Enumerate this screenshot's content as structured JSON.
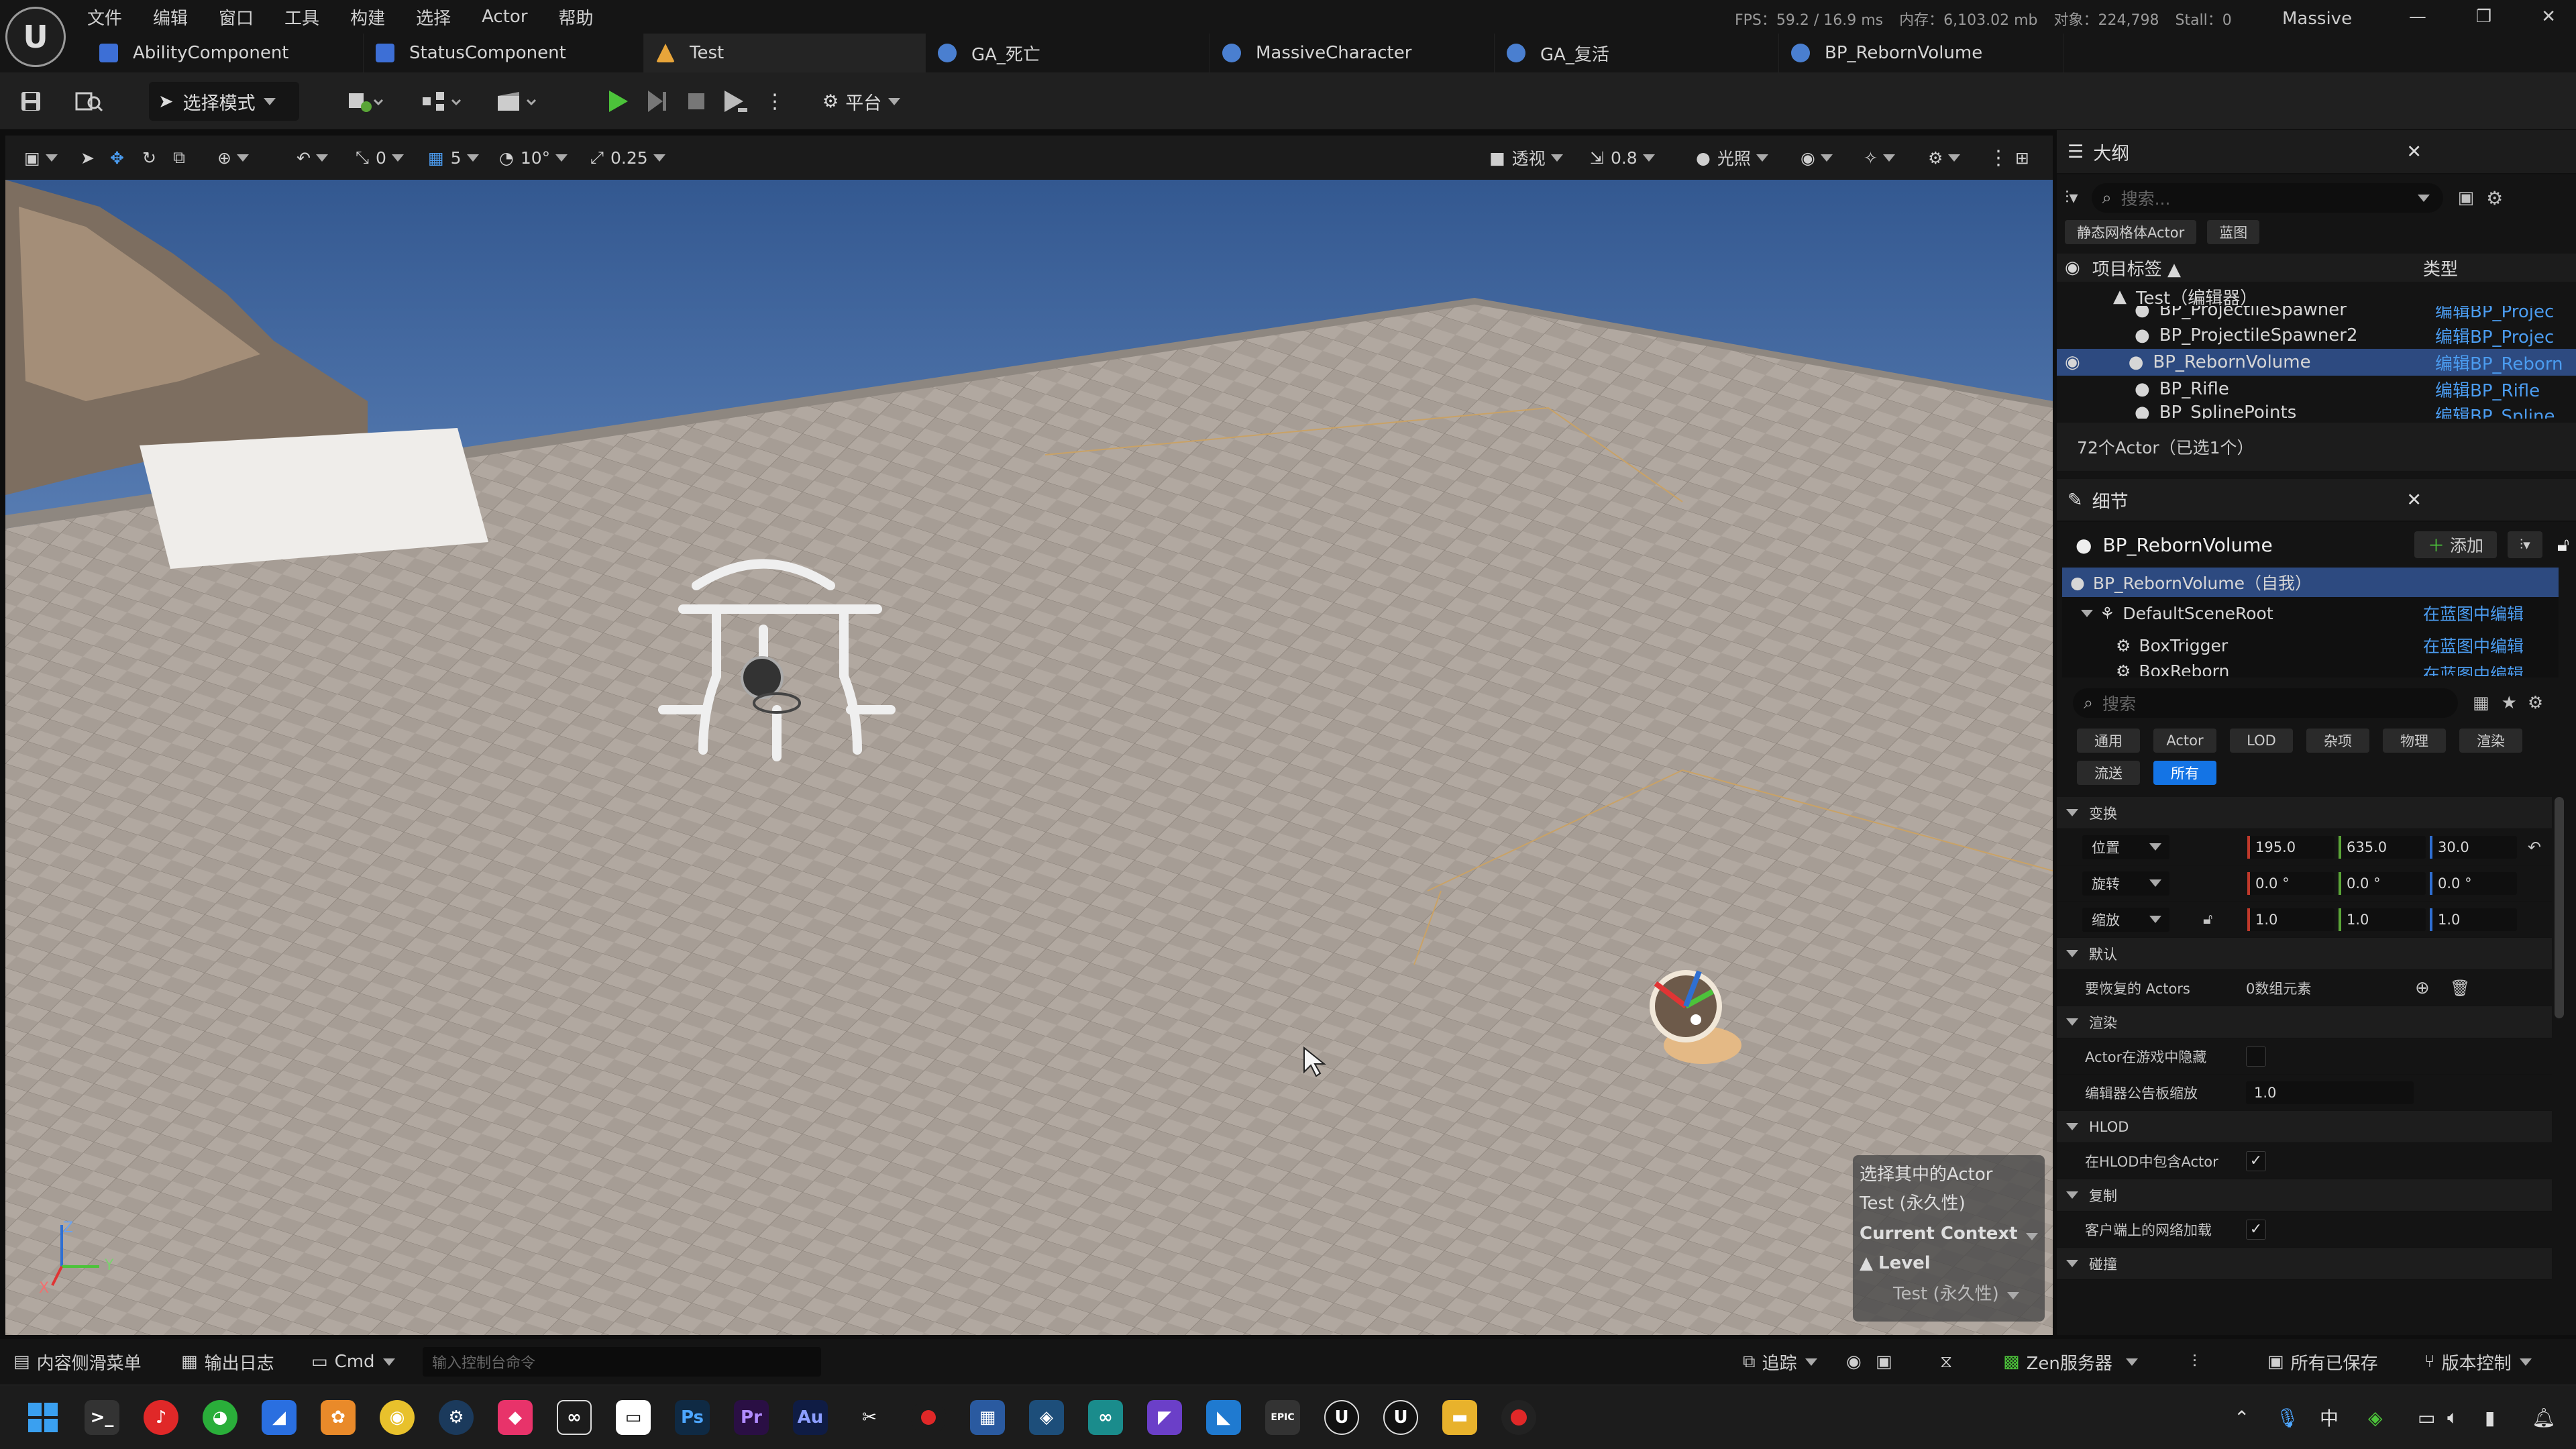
{
  "app": {
    "logo_text": "U",
    "project": "Massive"
  },
  "menu": [
    "文件",
    "编辑",
    "窗口",
    "工具",
    "构建",
    "选择",
    "Actor",
    "帮助"
  ],
  "stats": {
    "fps": "FPS：59.2  / 16.9 ms",
    "mem": "内存：6,103.02 mb",
    "objects": "对象：224,798",
    "stall": "Stall：0"
  },
  "window_controls": {
    "minimize": "—",
    "restore": "❐",
    "close": "✕"
  },
  "tabs": [
    {
      "label": "AbilityComponent",
      "color": "#3d6fd6"
    },
    {
      "label": "StatusComponent",
      "color": "#3d6fd6"
    },
    {
      "label": "Test",
      "color": "#e8a53a"
    },
    {
      "label": "GA_死亡",
      "color": "#4a7fd0"
    },
    {
      "label": "MassiveCharacter",
      "color": "#4a7fd0"
    },
    {
      "label": "GA_复活",
      "color": "#4a7fd0"
    },
    {
      "label": "BP_RebornVolume",
      "color": "#4a7fd0"
    }
  ],
  "toolbar": {
    "mode": "选择模式",
    "platform": "平台"
  },
  "viewport_bar": {
    "translate_snap": "0",
    "grid": "5",
    "rot_snap": "10°",
    "scale_snap": "0.25",
    "view": "透视",
    "cam_speed": "0.8",
    "lit": "光照"
  },
  "context": {
    "header": "选择其中的Actor",
    "sub": "Test (永久性)",
    "current": "Current Context",
    "level": "Level",
    "level_sub": "Test (永久性)"
  },
  "axis": {
    "x": "X",
    "y": "Y",
    "z": "Z"
  },
  "outliner": {
    "title": "大纲",
    "search_placeholder": "搜索...",
    "filters": [
      "静态网格体Actor",
      "蓝图"
    ],
    "col_label": "项目标签 ▲",
    "col_type": "类型",
    "root": "Test（编辑器）",
    "rows": [
      {
        "name": "BP_ProjectileSpawner",
        "type": "编辑BP_Projec"
      },
      {
        "name": "BP_ProjectileSpawner2",
        "type": "编辑BP_Projec"
      },
      {
        "name": "BP_RebornVolume",
        "type": "编辑BP_Reborn"
      },
      {
        "name": "BP_Rifle",
        "type": "编辑BP_Rifle"
      },
      {
        "name": "BP_SplinePoints",
        "type": "编辑BP_Spline"
      }
    ],
    "count": "72个Actor（已选1个）"
  },
  "details": {
    "title": "细节",
    "actor": "BP_RebornVolume",
    "add": "添加",
    "components": [
      {
        "name": "BP_RebornVolume（自我）",
        "link": ""
      },
      {
        "name": "DefaultSceneRoot",
        "link": "在蓝图中编辑"
      },
      {
        "name": "BoxTrigger",
        "link": "在蓝图中编辑"
      },
      {
        "name": "BoxReborn",
        "link": "在蓝图中编辑"
      }
    ],
    "search_placeholder": "搜索",
    "cats_row1": [
      "通用",
      "Actor",
      "LOD",
      "杂项",
      "物理",
      "渲染"
    ],
    "cats_row2": [
      "流送",
      "所有"
    ],
    "transform": "变换",
    "location": {
      "label": "位置",
      "x": "195.0",
      "y": "635.0",
      "z": "30.0"
    },
    "rotation": {
      "label": "旋转",
      "x": "0.0 °",
      "y": "0.0 °",
      "z": "0.0 °"
    },
    "scale": {
      "label": "缩放",
      "x": "1.0",
      "y": "1.0",
      "z": "1.0"
    },
    "default": "默认",
    "restore_actors": "要恢复的 Actors",
    "restore_value": "0数组元素",
    "render": "渲染",
    "hide_in_game": "Actor在游戏中隐藏",
    "billboard_scale": "编辑器公告板缩放",
    "billboard_value": "1.0",
    "hlod": "HLOD",
    "include_hlod": "在HLOD中包含Actor",
    "replication": "复制",
    "net_load": "客户端上的网络加载",
    "collision": "碰撞"
  },
  "statusbar": {
    "content_drawer": "内容侧滑菜单",
    "output_log": "输出日志",
    "cmd": "Cmd",
    "cmd_placeholder": "输入控制台命令",
    "trace": "追踪",
    "zen": "Zen服务器",
    "saved": "所有已保存",
    "source_control": "版本控制"
  },
  "taskbar": {
    "ime": "中"
  }
}
